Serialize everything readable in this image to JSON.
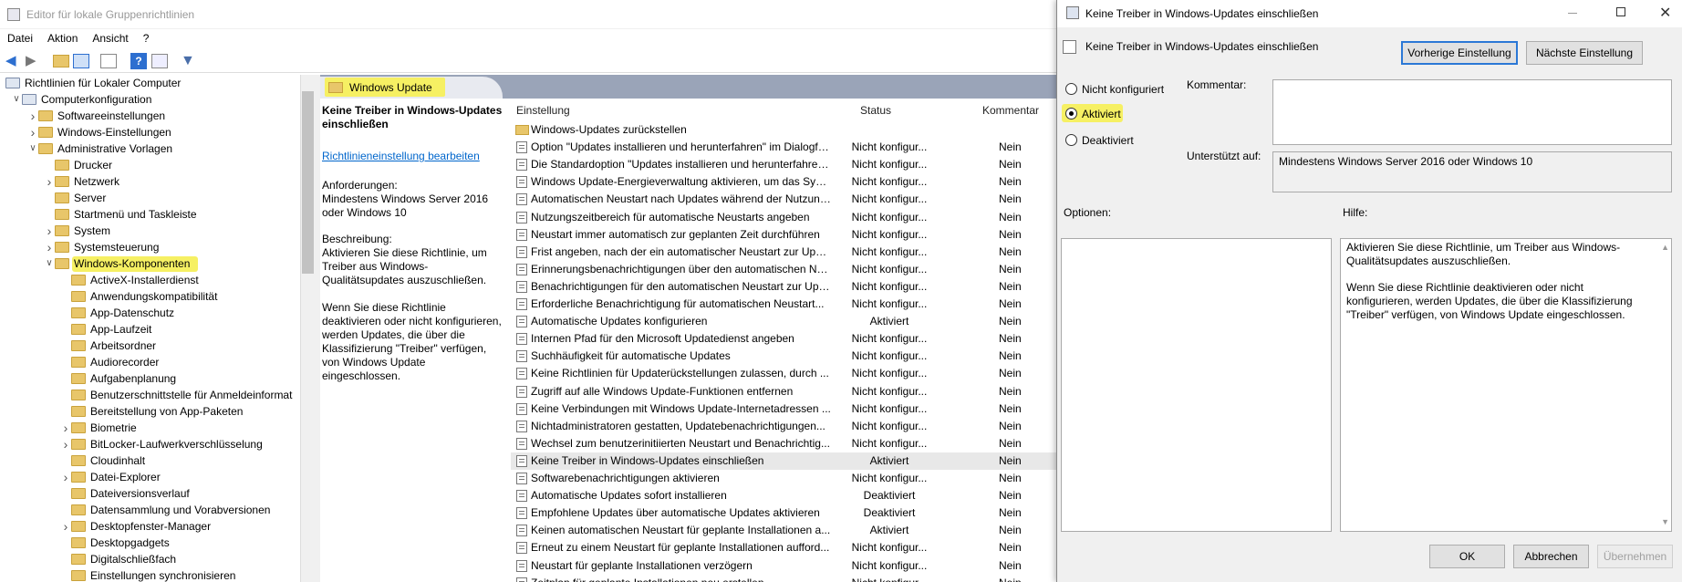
{
  "window": {
    "title": "Editor für lokale Gruppenrichtlinien"
  },
  "menu": [
    "Datei",
    "Aktion",
    "Ansicht",
    "?"
  ],
  "tree": [
    {
      "label": "Richtlinien für Lokaler Computer",
      "level": 0,
      "expander": "",
      "icon": "computer"
    },
    {
      "label": "Computerkonfiguration",
      "level": 1,
      "expander": "open",
      "icon": "computer"
    },
    {
      "label": "Softwareeinstellungen",
      "level": 2,
      "expander": "closed",
      "icon": "folder"
    },
    {
      "label": "Windows-Einstellungen",
      "level": 2,
      "expander": "closed",
      "icon": "folder"
    },
    {
      "label": "Administrative Vorlagen",
      "level": 2,
      "expander": "open",
      "icon": "folder"
    },
    {
      "label": "Drucker",
      "level": 3,
      "expander": "",
      "icon": "folder"
    },
    {
      "label": "Netzwerk",
      "level": 3,
      "expander": "closed",
      "icon": "folder"
    },
    {
      "label": "Server",
      "level": 3,
      "expander": "",
      "icon": "folder"
    },
    {
      "label": "Startmenü und Taskleiste",
      "level": 3,
      "expander": "",
      "icon": "folder"
    },
    {
      "label": "System",
      "level": 3,
      "expander": "closed",
      "icon": "folder"
    },
    {
      "label": "Systemsteuerung",
      "level": 3,
      "expander": "closed",
      "icon": "folder"
    },
    {
      "label": "Windows-Komponenten",
      "level": 3,
      "expander": "open",
      "icon": "folder",
      "highlight": true
    },
    {
      "label": "ActiveX-Installerdienst",
      "level": 4,
      "expander": "",
      "icon": "folder"
    },
    {
      "label": "Anwendungskompatibilität",
      "level": 4,
      "expander": "",
      "icon": "folder"
    },
    {
      "label": "App-Datenschutz",
      "level": 4,
      "expander": "",
      "icon": "folder"
    },
    {
      "label": "App-Laufzeit",
      "level": 4,
      "expander": "",
      "icon": "folder"
    },
    {
      "label": "Arbeitsordner",
      "level": 4,
      "expander": "",
      "icon": "folder"
    },
    {
      "label": "Audiorecorder",
      "level": 4,
      "expander": "",
      "icon": "folder"
    },
    {
      "label": "Aufgabenplanung",
      "level": 4,
      "expander": "",
      "icon": "folder"
    },
    {
      "label": "Benutzerschnittstelle für Anmeldeinformat",
      "level": 4,
      "expander": "",
      "icon": "folder"
    },
    {
      "label": "Bereitstellung von App-Paketen",
      "level": 4,
      "expander": "",
      "icon": "folder"
    },
    {
      "label": "Biometrie",
      "level": 4,
      "expander": "closed",
      "icon": "folder"
    },
    {
      "label": "BitLocker-Laufwerkverschlüsselung",
      "level": 4,
      "expander": "closed",
      "icon": "folder"
    },
    {
      "label": "Cloudinhalt",
      "level": 4,
      "expander": "",
      "icon": "folder"
    },
    {
      "label": "Datei-Explorer",
      "level": 4,
      "expander": "closed",
      "icon": "folder"
    },
    {
      "label": "Dateiversionsverlauf",
      "level": 4,
      "expander": "",
      "icon": "folder"
    },
    {
      "label": "Datensammlung und Vorabversionen",
      "level": 4,
      "expander": "",
      "icon": "folder"
    },
    {
      "label": "Desktopfenster-Manager",
      "level": 4,
      "expander": "closed",
      "icon": "folder"
    },
    {
      "label": "Desktopgadgets",
      "level": 4,
      "expander": "",
      "icon": "folder"
    },
    {
      "label": "Digitalschließfach",
      "level": 4,
      "expander": "",
      "icon": "folder"
    },
    {
      "label": "Einstellungen synchronisieren",
      "level": 4,
      "expander": "",
      "icon": "folder"
    }
  ],
  "pane": {
    "header": "Windows Update",
    "desc_title": "Keine Treiber in Windows-Updates einschließen",
    "edit_link": "Richtlinieneinstellung bearbeiten",
    "req_label": "Anforderungen:",
    "req_text": "Mindestens Windows Server 2016 oder Windows 10",
    "desc_label": "Beschreibung:",
    "desc_text1": "Aktivieren Sie diese Richtlinie, um Treiber aus Windows-Qualitätsupdates auszuschließen.",
    "desc_text2": "Wenn Sie diese Richtlinie deaktivieren oder nicht konfigurieren, werden Updates, die über die Klassifizierung \"Treiber\" verfügen, von Windows Update eingeschlossen."
  },
  "columns": {
    "setting": "Einstellung",
    "status": "Status",
    "comment": "Kommentar"
  },
  "rows": [
    {
      "name": "Windows-Updates zurückstellen",
      "status": "",
      "comment": "",
      "folder": true
    },
    {
      "name": "Option \"Updates installieren und herunterfahren\" im Dialogfeld...",
      "status": "Nicht konfigur...",
      "comment": "Nein"
    },
    {
      "name": "Die Standardoption \"Updates installieren und herunterfahren\"...",
      "status": "Nicht konfigur...",
      "comment": "Nein"
    },
    {
      "name": "Windows Update-Energieverwaltung aktivieren, um das System...",
      "status": "Nicht konfigur...",
      "comment": "Nein"
    },
    {
      "name": "Automatischen Neustart nach Updates während der Nutzungszeit...",
      "status": "Nicht konfigur...",
      "comment": "Nein"
    },
    {
      "name": "Nutzungszeitbereich für automatische Neustarts angeben",
      "status": "Nicht konfigur...",
      "comment": "Nein"
    },
    {
      "name": "Neustart immer automatisch zur geplanten Zeit durchführen",
      "status": "Nicht konfigur...",
      "comment": "Nein"
    },
    {
      "name": "Frist angeben, nach der ein automatischer Neustart zur Update...",
      "status": "Nicht konfigur...",
      "comment": "Nein"
    },
    {
      "name": "Erinnerungsbenachrichtigungen über den automatischen Neustart...",
      "status": "Nicht konfigur...",
      "comment": "Nein"
    },
    {
      "name": "Benachrichtigungen für den automatischen Neustart zur Update...",
      "status": "Nicht konfigur...",
      "comment": "Nein"
    },
    {
      "name": "Erforderliche Benachrichtigung für automatischen Neustart...",
      "status": "Nicht konfigur...",
      "comment": "Nein"
    },
    {
      "name": "Automatische Updates konfigurieren",
      "status": "Aktiviert",
      "comment": "Nein"
    },
    {
      "name": "Internen Pfad für den Microsoft Updatedienst angeben",
      "status": "Nicht konfigur...",
      "comment": "Nein"
    },
    {
      "name": "Suchhäufigkeit für automatische Updates",
      "status": "Nicht konfigur...",
      "comment": "Nein"
    },
    {
      "name": "Keine Richtlinien für Updaterückstellungen zulassen, durch ...",
      "status": "Nicht konfigur...",
      "comment": "Nein"
    },
    {
      "name": "Zugriff auf alle Windows Update-Funktionen entfernen",
      "status": "Nicht konfigur...",
      "comment": "Nein"
    },
    {
      "name": "Keine Verbindungen mit Windows Update-Internetadressen ...",
      "status": "Nicht konfigur...",
      "comment": "Nein"
    },
    {
      "name": "Nichtadministratoren gestatten, Updatebenachrichtigungen...",
      "status": "Nicht konfigur...",
      "comment": "Nein"
    },
    {
      "name": "Wechsel zum benutzerinitiierten Neustart und Benachrichtig...",
      "status": "Nicht konfigur...",
      "comment": "Nein"
    },
    {
      "name": "Keine Treiber in Windows-Updates einschließen",
      "status": "Aktiviert",
      "comment": "Nein",
      "selected": true
    },
    {
      "name": "Softwarebenachrichtigungen aktivieren",
      "status": "Nicht konfigur...",
      "comment": "Nein"
    },
    {
      "name": "Automatische Updates sofort installieren",
      "status": "Deaktiviert",
      "comment": "Nein"
    },
    {
      "name": "Empfohlene Updates über automatische Updates aktivieren",
      "status": "Deaktiviert",
      "comment": "Nein"
    },
    {
      "name": "Keinen automatischen Neustart für geplante Installationen a...",
      "status": "Aktiviert",
      "comment": "Nein"
    },
    {
      "name": "Erneut zu einem Neustart für geplante Installationen aufford...",
      "status": "Nicht konfigur...",
      "comment": "Nein"
    },
    {
      "name": "Neustart für geplante Installationen verzögern",
      "status": "Nicht konfigur...",
      "comment": "Nein"
    },
    {
      "name": "Zeitplan für geplante Installationen neu erstellen",
      "status": "Nicht konfigur...",
      "comment": "Nein"
    }
  ],
  "dialog": {
    "title": "Keine Treiber in Windows-Updates einschließen",
    "policy_name": "Keine Treiber in Windows-Updates einschließen",
    "prev_button": "Vorherige Einstellung",
    "next_button": "Nächste Einstellung",
    "opt_not_configured": "Nicht konfiguriert",
    "opt_enabled": "Aktiviert",
    "opt_disabled": "Deaktiviert",
    "selected_option": "Aktiviert",
    "comment_label": "Kommentar:",
    "comment_value": "",
    "supported_label": "Unterstützt auf:",
    "supported_value": "Mindestens Windows Server 2016 oder Windows 10",
    "options_label": "Optionen:",
    "help_label": "Hilfe:",
    "help_p1": "Aktivieren Sie diese Richtlinie, um Treiber aus Windows-Qualitätsupdates auszuschließen.",
    "help_p2": "Wenn Sie diese Richtlinie deaktivieren oder nicht konfigurieren, werden Updates, die über die Klassifizierung \"Treiber\" verfügen, von Windows Update eingeschlossen.",
    "ok": "OK",
    "cancel": "Abbrechen",
    "apply": "Übernehmen"
  },
  "colors": {
    "highlight": "#f6f063",
    "link": "#0066cc",
    "header_band": "#9aa4b8"
  }
}
